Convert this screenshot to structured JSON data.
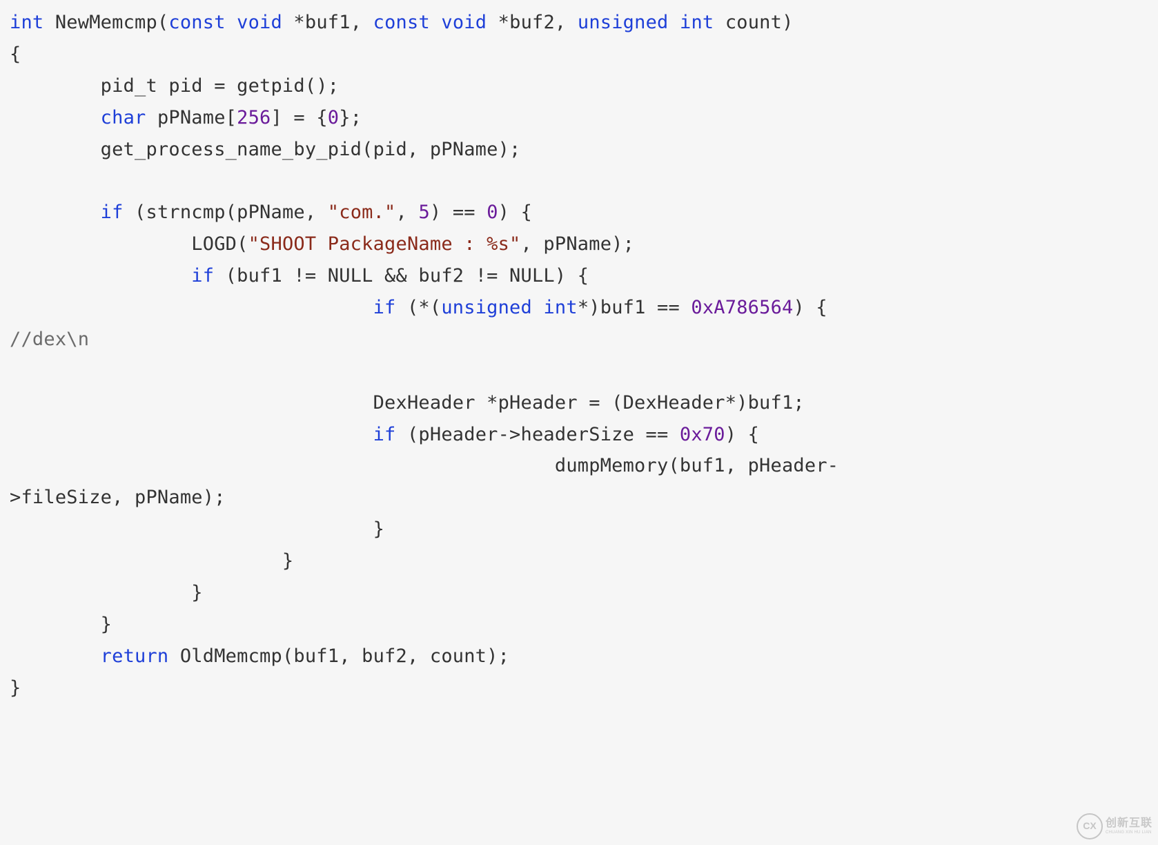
{
  "code": {
    "l1": {
      "kw_int": "int",
      "fn": " NewMemcmp(",
      "kw_const1": "const",
      "sp1": " ",
      "kw_void1": "void",
      "p1": " *buf1, ",
      "kw_const2": "const",
      "sp2": " ",
      "kw_void2": "void",
      "p2": " *buf2, ",
      "kw_unsigned": "unsigned",
      "sp3": " ",
      "kw_int2": "int",
      "p3": " count)"
    },
    "l2": "{",
    "l3": {
      "indent": "        pid_t pid = getpid();"
    },
    "l4": {
      "indent": "        ",
      "kw_char": "char",
      "mid": " pPName[",
      "num256": "256",
      "after": "] = {",
      "num0": "0",
      "end": "};"
    },
    "l5": "        get_process_name_by_pid(pid, pPName);",
    "l6": "",
    "l7": {
      "indent": "        ",
      "kw_if": "if",
      "open": " (strncmp(pPName, ",
      "str_com": "\"com.\"",
      "comma": ", ",
      "num5": "5",
      "cmp": ") == ",
      "num0": "0",
      "end": ") {"
    },
    "l8": {
      "indent": "                LOGD(",
      "str": "\"SHOOT PackageName : %s\"",
      "end": ", pPName);"
    },
    "l9": {
      "indent": "                ",
      "kw_if": "if",
      "body": " (buf1 != NULL && buf2 != NULL) {"
    },
    "l10": {
      "indent": "                                ",
      "kw_if": "if",
      "open": " (*(",
      "kw_unsigned": "unsigned",
      "sp": " ",
      "kw_int": "int",
      "cast": "*)buf1 == ",
      "hex": "0xA786564",
      "end": ") {  "
    },
    "l11": {
      "cmt": "//dex\\n"
    },
    "l12": "",
    "l13": "                                DexHeader *pHeader = (DexHeader*)buf1;",
    "l14": {
      "indent": "                                ",
      "kw_if": "if",
      "open": " (pHeader->headerSize == ",
      "hex": "0x70",
      "end": ") {"
    },
    "l15": "                                                dumpMemory(buf1, pHeader-",
    "l16": ">fileSize, pPName);",
    "l17": "                                }",
    "l18": "                        }",
    "l19": "                }",
    "l20": "        }",
    "l21": {
      "indent": "        ",
      "kw_return": "return",
      "body": " OldMemcmp(buf1, buf2, count);"
    },
    "l22": "}"
  },
  "watermark": {
    "badge": "CX",
    "zh": "创新互联",
    "py": "CHUANG XIN HU LIAN"
  }
}
